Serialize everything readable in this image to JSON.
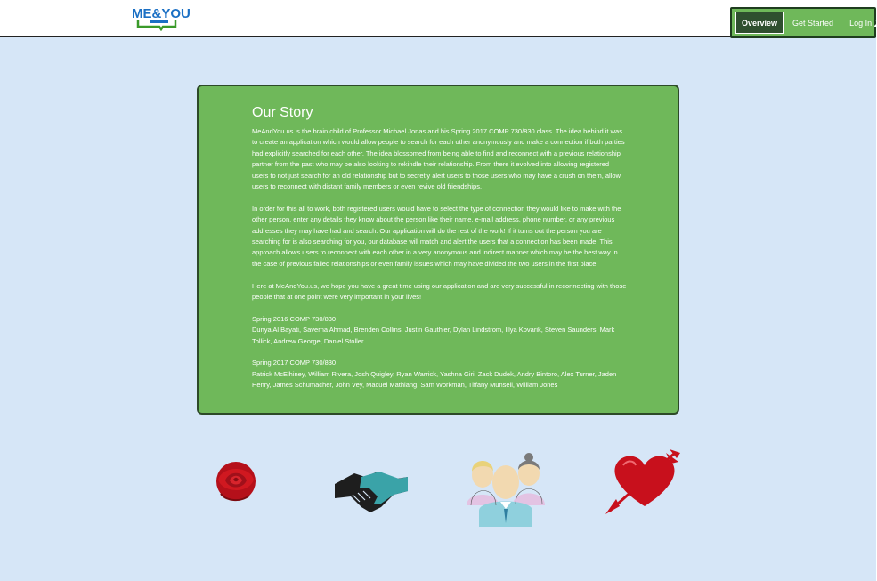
{
  "header": {
    "logo_text": "ME&YOU",
    "nav": {
      "overview": "Overview",
      "get_started": "Get Started",
      "log_in": "Log In"
    }
  },
  "story": {
    "title": "Our Story",
    "paragraphs": [
      "MeAndYou.us is the brain child of Professor Michael Jonas and his Spring 2017 COMP 730/830 class. The idea behind it was to create an application which would allow people to search for each other anonymously and make a connection if both parties had explicitly searched for each other. The idea blossomed from being able to find and reconnect with a previous relationship partner from the past who may be also looking to rekindle their relationship. From there it evolved into allowing registered users to not just search for an old relationship but to secretly alert users to those users who may have a crush on them, allow users to reconnect with distant family members or even revive old friendships.",
      "In order for this all to work, both registered users would have to select the type of connection they would like to make with the other person, enter any details they know about the person like their name, e-mail address, phone number, or any previous addresses they may have had and search. Our application will do the rest of the work! If it turns out the person you are searching for is also searching for you, our database will match and alert the users that a connection has been made. This approach allows users to reconnect with each other in a very anonymous and indirect manner which may be the best way in the case of previous failed relationships or even family issues which may have divided the two users in the first place.",
      "Here at MeAndYou.us, we hope you have a great time using our application and are very successful in reconnecting with those people that at one point were very important in your lives!"
    ],
    "class_2016_heading": "Spring 2016 COMP 730/830",
    "class_2016_members": "Dunya Al Bayati, Saverna Ahmad, Brenden Collins, Justin Gauthier, Dylan Lindstrom, Illya Kovarik, Steven Saunders, Mark Tollick, Andrew George, Daniel Stoller",
    "class_2017_heading": "Spring 2017 COMP 730/830",
    "class_2017_members": "Patrick McElhiney, William Rivera, Josh Quigley, Ryan Warrick, Yashna Giri, Zack Dudek, Andry Bintoro, Alex Turner, Jaden Henry, James Schumacher, John Vey, Macuei Mathiang, Sam Workman, Tiffany Munsell, William Jones"
  },
  "icons": [
    "rose-icon",
    "handshake-icon",
    "people-icon",
    "heart-arrow-icon"
  ],
  "colors": {
    "background": "#d6e6f7",
    "card": "#6fb85a",
    "card_border": "#2d4a28",
    "nav_active": "#2f4f2f",
    "logo_green": "#3a9a2a",
    "logo_blue": "#1a6fc4"
  }
}
